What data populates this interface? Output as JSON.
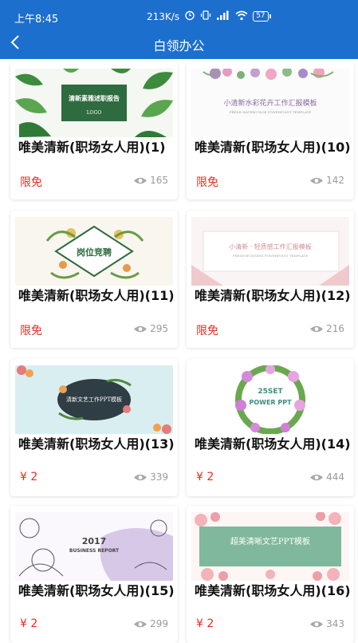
{
  "status": {
    "time": "上午8:45",
    "speed": "213K/s",
    "battery": "57"
  },
  "header": {
    "title": "白领办公",
    "back_icon": "chevron-left-icon"
  },
  "colors": {
    "primary": "#1d6fce",
    "price": "#e32f22",
    "views": "#9a9a9a"
  },
  "items": [
    {
      "title": "唯美清新(职场女人用)(1)",
      "price": "限免",
      "views": "165",
      "thumb_line1": "清新素雅述职报告",
      "thumb_line2": "LOGO"
    },
    {
      "title": "唯美清新(职场女人用)(10)",
      "price": "限免",
      "views": "142",
      "thumb_line1": "小清新水彩花卉工作汇报模板",
      "thumb_line2": "FRESH WATERCOLOR POWERPOINT TEMPLATE"
    },
    {
      "title": "唯美清新(职场女人用)(11)",
      "price": "限免",
      "views": "295",
      "thumb_line1": "岗位竞聘",
      "thumb_line2": ""
    },
    {
      "title": "唯美清新(职场女人用)(12)",
      "price": "限免",
      "views": "216",
      "thumb_line1": "小清新 · 轻质感工作汇报模板",
      "thumb_line2": "FRESH BUSINESS POWERPOINT TEMPLATE"
    },
    {
      "title": "唯美清新(职场女人用)(13)",
      "price": "¥ 2",
      "views": "339",
      "thumb_line1": "清新文艺工作PPT模板",
      "thumb_line2": ""
    },
    {
      "title": "唯美清新(职场女人用)(14)",
      "price": "¥ 2",
      "views": "444",
      "thumb_line1": "25SET",
      "thumb_line2": "POWER PPT"
    },
    {
      "title": "唯美清新(职场女人用)(15)",
      "price": "¥ 2",
      "views": "299",
      "thumb_line1": "2017",
      "thumb_line2": "BUSINESS REPORT"
    },
    {
      "title": "唯美清新(职场女人用)(16)",
      "price": "¥ 2",
      "views": "343",
      "thumb_line1": "超美清晰文艺PPT模板",
      "thumb_line2": ""
    }
  ]
}
